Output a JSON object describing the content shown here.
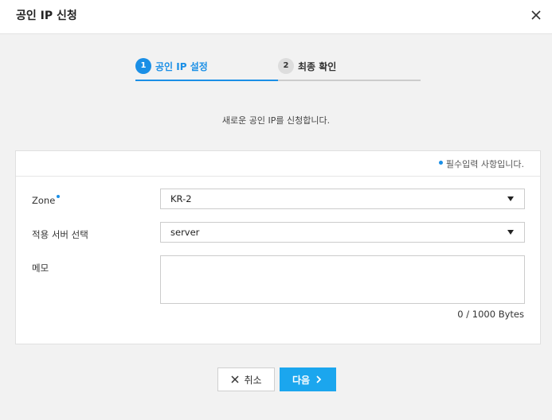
{
  "dialog": {
    "title": "공인 IP 신청",
    "close_icon": "close-icon"
  },
  "steps": [
    {
      "number": "1",
      "label": "공인 IP 설정",
      "active": true
    },
    {
      "number": "2",
      "label": "최종 확인",
      "active": false
    }
  ],
  "description": "새로운 공인 IP를 신청합니다.",
  "form": {
    "required_note": "필수입력 사항입니다.",
    "zone": {
      "label": "Zone",
      "value": "KR-2",
      "required": true
    },
    "server": {
      "label": "적용 서버 선택",
      "value": "server"
    },
    "memo": {
      "label": "메모",
      "value": "",
      "byte_count": "0 / 1000 Bytes"
    }
  },
  "buttons": {
    "cancel_label": "취소",
    "next_label": "다음"
  },
  "colors": {
    "accent": "#1a8fe6",
    "primary_button": "#1ba6ee",
    "background": "#f2f2f2"
  }
}
